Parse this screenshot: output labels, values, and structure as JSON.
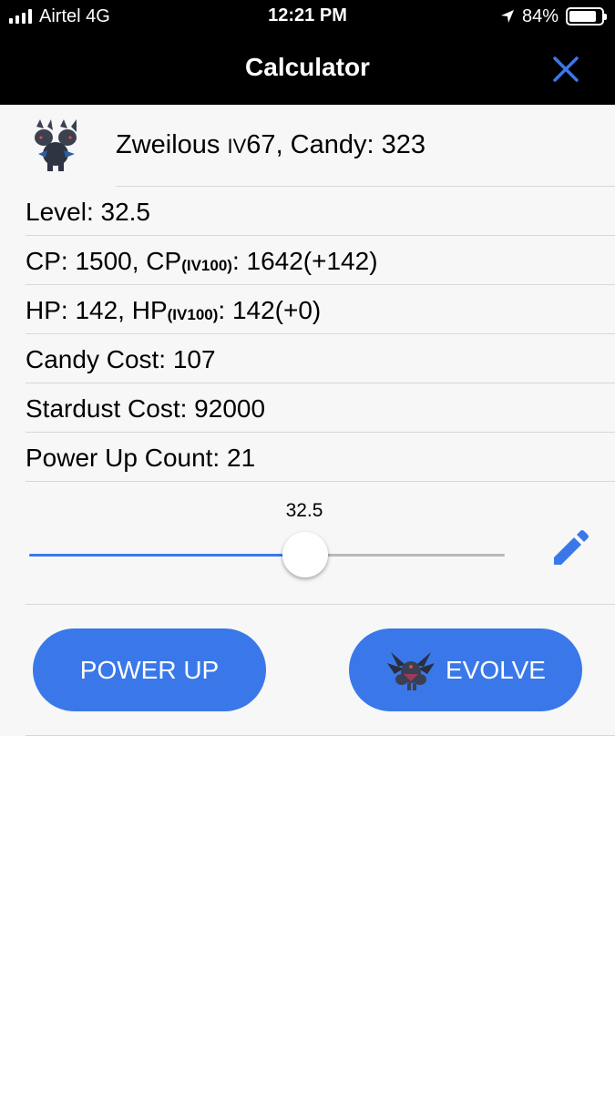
{
  "status_bar": {
    "carrier": "Airtel 4G",
    "time": "12:21 PM",
    "battery": "84%",
    "battery_level": 0.84
  },
  "nav": {
    "title": "Calculator",
    "close_icon": "close-icon"
  },
  "pokemon": {
    "name": "Zweilous",
    "iv_label": "IV",
    "iv_value": "67",
    "candy_text": ", Candy: 323"
  },
  "rows": {
    "level": "Level: 32.5",
    "cp_a": "CP: 1500, CP",
    "cp_sub": "(IV100)",
    "cp_b": ": 1642(+142)",
    "hp_a": "HP: 142, HP",
    "hp_sub": "(IV100)",
    "hp_b": ": 142(+0)",
    "candy_cost": "Candy Cost: 107",
    "stardust_cost": "Stardust Cost: 92000",
    "power_up_count": "Power Up Count: 21"
  },
  "slider": {
    "value_label": "32.5",
    "fraction": 0.58
  },
  "buttons": {
    "power_up": "POWER UP",
    "evolve": "EVOLVE"
  },
  "colors": {
    "accent": "#3a78ea",
    "panel": "#f7f7f7"
  }
}
